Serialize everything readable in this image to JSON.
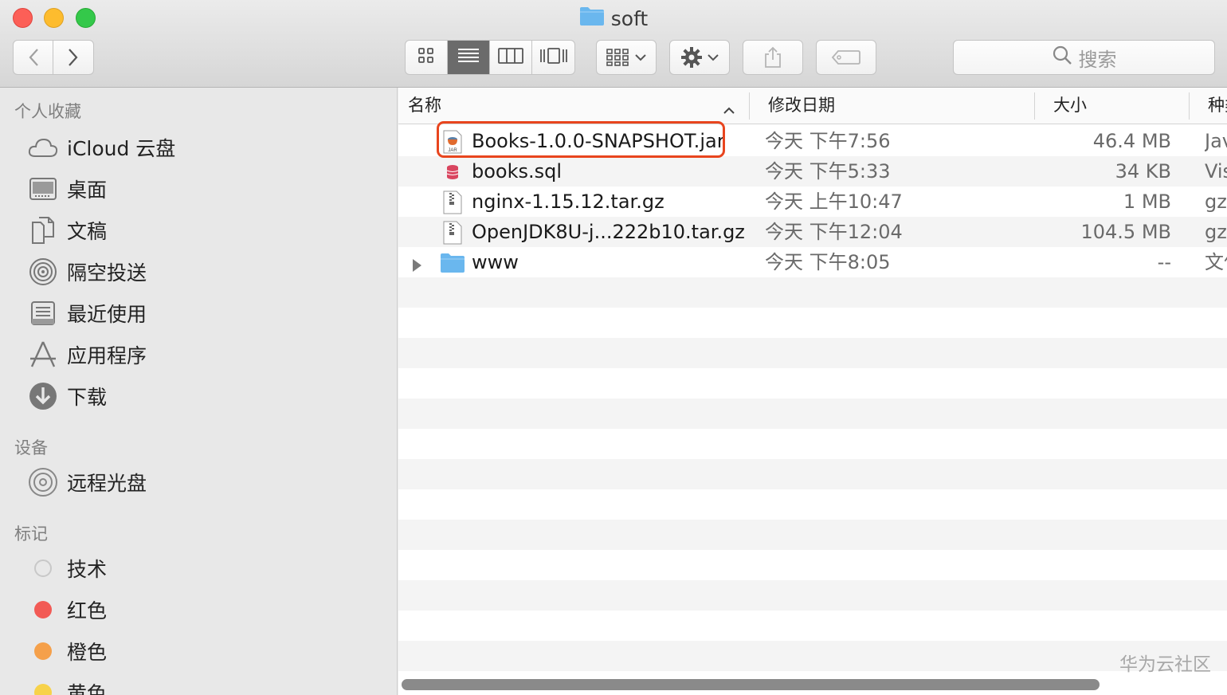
{
  "window": {
    "title": "soft"
  },
  "toolbar": {
    "back_icon": "chevron-left-icon",
    "forward_icon": "chevron-right-icon",
    "views": [
      "icon-view",
      "list-view",
      "column-view",
      "cover-flow-view"
    ],
    "active_view": "list-view",
    "search_placeholder": "搜索"
  },
  "sidebar": {
    "favorites_header": "个人收藏",
    "favorites": [
      {
        "label": "iCloud 云盘",
        "icon": "cloud-icon"
      },
      {
        "label": "桌面",
        "icon": "desktop-icon"
      },
      {
        "label": "文稿",
        "icon": "documents-icon"
      },
      {
        "label": "隔空投送",
        "icon": "airdrop-icon"
      },
      {
        "label": "最近使用",
        "icon": "recents-icon"
      },
      {
        "label": "应用程序",
        "icon": "applications-icon"
      },
      {
        "label": "下载",
        "icon": "downloads-icon"
      }
    ],
    "devices_header": "设备",
    "devices": [
      {
        "label": "远程光盘",
        "icon": "disc-icon"
      }
    ],
    "tags_header": "标记",
    "tags": [
      {
        "label": "技术",
        "color": "#e0e0e0"
      },
      {
        "label": "红色",
        "color": "#f25a55"
      },
      {
        "label": "橙色",
        "color": "#f5a04a"
      },
      {
        "label": "黄色",
        "color": "#f7d24a"
      }
    ]
  },
  "list": {
    "columns": {
      "name": "名称",
      "modified": "修改日期",
      "size": "大小",
      "kind": "种类"
    },
    "rows": [
      {
        "name": "Books-1.0.0-SNAPSHOT.jar",
        "modified": "今天 下午7:56",
        "size": "46.4 MB",
        "kind": "Java JAR 文件",
        "icon": "jar-file-icon",
        "highlighted": true
      },
      {
        "name": "books.sql",
        "modified": "今天 下午5:33",
        "size": "34 KB",
        "kind": "Visual Studio Code",
        "icon": "sql-file-icon"
      },
      {
        "name": "nginx-1.15.12.tar.gz",
        "modified": "今天 上午10:47",
        "size": "1 MB",
        "kind": "gzip 压缩归档",
        "icon": "archive-file-icon"
      },
      {
        "name": "OpenJDK8U-j...222b10.tar.gz",
        "modified": "今天 下午12:04",
        "size": "104.5 MB",
        "kind": "gzip 压缩归档",
        "icon": "archive-file-icon"
      },
      {
        "name": "www",
        "modified": "今天 下午8:05",
        "size": "--",
        "kind": "文件夹",
        "icon": "folder-icon"
      }
    ]
  },
  "watermark": "华为云社区",
  "colors": {
    "highlight": "#e8451e",
    "folder": "#6ab7ee"
  }
}
